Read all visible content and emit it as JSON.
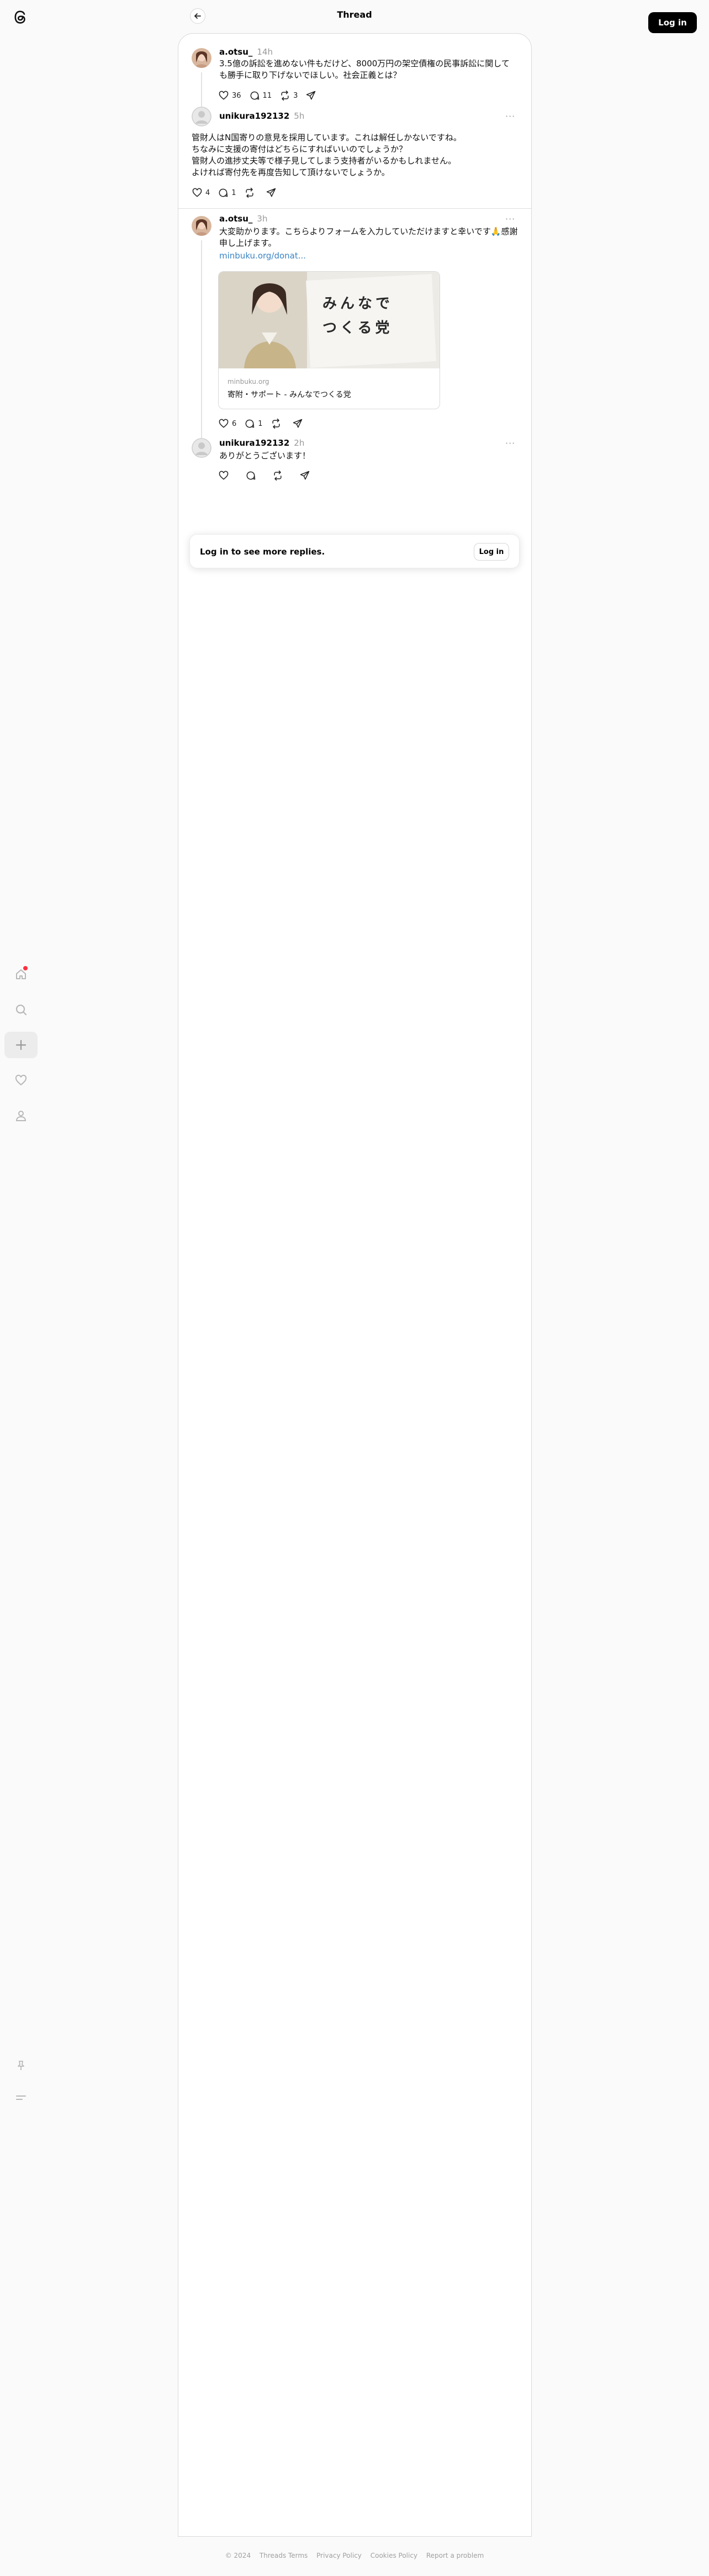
{
  "header": {
    "title": "Thread",
    "login_label": "Log in",
    "back_icon": "arrow-left-icon"
  },
  "sidebar": {
    "logo": "threads-logo",
    "items": [
      {
        "icon": "home-icon"
      },
      {
        "icon": "search-icon"
      },
      {
        "icon": "create-plus-icon"
      },
      {
        "icon": "heart-icon"
      },
      {
        "icon": "profile-icon"
      }
    ],
    "bottom": [
      {
        "icon": "pin-icon"
      },
      {
        "icon": "menu-icon"
      }
    ]
  },
  "posts": [
    {
      "username": "a.otsu_",
      "time": "14h",
      "text": "3.5億の訴訟を進めない件もだけど、8000万円の架空債権の民事訴訟に関しても勝手に取り下げないでほしい。社会正義とは？",
      "likes": "36",
      "replies": "11",
      "reposts": "3"
    },
    {
      "username": "unikura192132",
      "time": "5h",
      "text": "管財人はN国寄りの意見を採用しています。これは解任しかないですね。\nちなみに支援の寄付はどちらにすればいいのでしょうか？\n管財人の進捗丈夫等で様子見してしまう支持者がいるかもしれません。\nよければ寄付先を再度告知して頂けないでしょうか。",
      "likes": "4",
      "replies": "1",
      "reposts": ""
    },
    {
      "username": "a.otsu_",
      "time": "3h",
      "text": "大変助かります。こちらよりフォームを入力していただけますと幸いです🙏感謝申し上げます。",
      "link": "minbuku.org/donat...",
      "link_card": {
        "image_text": [
          "みんなで",
          "つくる党"
        ],
        "domain": "minbuku.org",
        "title": "寄附・サポート - みんなでつくる党"
      },
      "likes": "6",
      "replies": "1",
      "reposts": ""
    },
    {
      "username": "unikura192132",
      "time": "2h",
      "text": "ありがとうございます！",
      "likes": "",
      "replies": "",
      "reposts": ""
    }
  ],
  "login_more": {
    "text": "Log in to see more replies.",
    "button": "Log in"
  },
  "footer": {
    "items": [
      "© 2024",
      "Threads Terms",
      "Privacy Policy",
      "Cookies Policy",
      "Report a problem"
    ]
  }
}
